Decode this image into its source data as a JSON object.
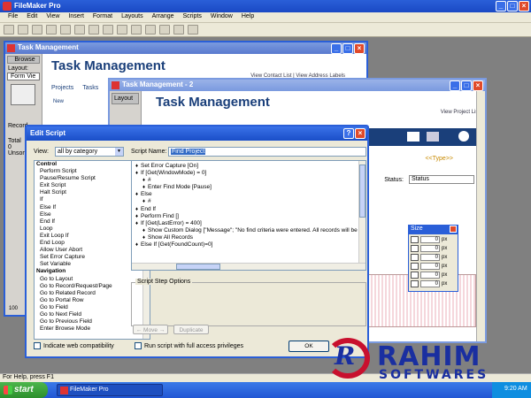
{
  "app": {
    "title": "FileMaker Pro"
  },
  "menu": [
    "File",
    "Edit",
    "View",
    "Insert",
    "Format",
    "Layouts",
    "Arrange",
    "Scripts",
    "Window",
    "Help"
  ],
  "window1": {
    "title": "Task Management",
    "mode": "Browse",
    "layout_label": "Layout:",
    "layout_value": "Form Vie",
    "heading": "Task Management",
    "links": "View Contact List  |  View Address Labels",
    "tabs": [
      "Projects",
      "Tasks"
    ],
    "new_label": "New",
    "record_label": "Record",
    "total_label": "Total",
    "total_value": "0",
    "unsorted_label": "Unsorte",
    "zoom": "100"
  },
  "window2": {
    "title": "Task Management - 2",
    "layout_label": "Layout",
    "heading": "Task Management",
    "link": "View Project List",
    "tabs": [
      "Projects",
      "Tasks",
      "Contacts"
    ],
    "type_placeholder": "<<Type>>",
    "status_label": "Status:",
    "status_value": "Status"
  },
  "size_palette": {
    "title": "Size",
    "rows": [
      {
        "value": "0",
        "unit": "px"
      },
      {
        "value": "0",
        "unit": "px"
      },
      {
        "value": "0",
        "unit": "px"
      },
      {
        "value": "0",
        "unit": "px"
      },
      {
        "value": "0",
        "unit": "px"
      },
      {
        "value": "0",
        "unit": "px"
      }
    ]
  },
  "dialog": {
    "title": "Edit Script",
    "view_label": "View:",
    "view_value": "all by category",
    "script_name_label": "Script Name:",
    "script_name_value": "Find Project",
    "steps": [
      {
        "label": "Control",
        "cat": true
      },
      {
        "label": "Perform Script"
      },
      {
        "label": "Pause/Resume Script"
      },
      {
        "label": "Exit Script"
      },
      {
        "label": "Halt Script"
      },
      {
        "label": "If"
      },
      {
        "label": "Else If"
      },
      {
        "label": "Else"
      },
      {
        "label": "End If"
      },
      {
        "label": "Loop"
      },
      {
        "label": "Exit Loop If"
      },
      {
        "label": "End Loop"
      },
      {
        "label": "Allow User Abort"
      },
      {
        "label": "Set Error Capture"
      },
      {
        "label": "Set Variable"
      },
      {
        "label": "Navigation",
        "cat": true
      },
      {
        "label": "Go to Layout"
      },
      {
        "label": "Go to Record/Request/Page"
      },
      {
        "label": "Go to Related Record"
      },
      {
        "label": "Go to Portal Row"
      },
      {
        "label": "Go to Field"
      },
      {
        "label": "Go to Next Field"
      },
      {
        "label": "Go to Previous Field"
      },
      {
        "label": "Enter Browse Mode"
      }
    ],
    "script_lines": [
      {
        "indent": 0,
        "text": "Set Error Capture [On]"
      },
      {
        "indent": 0,
        "text": "If [Get(WindowMode) = 0]"
      },
      {
        "indent": 1,
        "text": "#"
      },
      {
        "indent": 1,
        "text": "Enter Find Mode [Pause]"
      },
      {
        "indent": 0,
        "text": "Else"
      },
      {
        "indent": 1,
        "text": "#"
      },
      {
        "indent": 0,
        "text": "End If"
      },
      {
        "indent": 0,
        "text": "Perform Find []"
      },
      {
        "indent": 0,
        "text": "If [Get(LastError) = 400]"
      },
      {
        "indent": 1,
        "text": "Show Custom Dialog [\"Message\"; \"No find criteria were entered. All records will be"
      },
      {
        "indent": 1,
        "text": "Show All Records"
      },
      {
        "indent": 0,
        "text": "Else If [Get(FoundCount)=0]"
      }
    ],
    "options_label": "Script Step Options",
    "move_label": "← Move →",
    "duplicate_label": "Duplicate",
    "web_compat_label": "Indicate web compatibility",
    "full_access_label": "Run script with full access privileges",
    "ok_label": "OK"
  },
  "statusbar": {
    "text": "For Help, press F1"
  },
  "taskbar": {
    "start_label": "start",
    "task_label": "FileMaker Pro",
    "clock": "9:20 AM"
  },
  "watermark": {
    "line1": "RAHIM",
    "line2": "SOFTWARES"
  },
  "colors": {
    "titlebar": "#2a5fd8",
    "heading": "#1a3f7a",
    "accent_type": "#c88a00"
  }
}
